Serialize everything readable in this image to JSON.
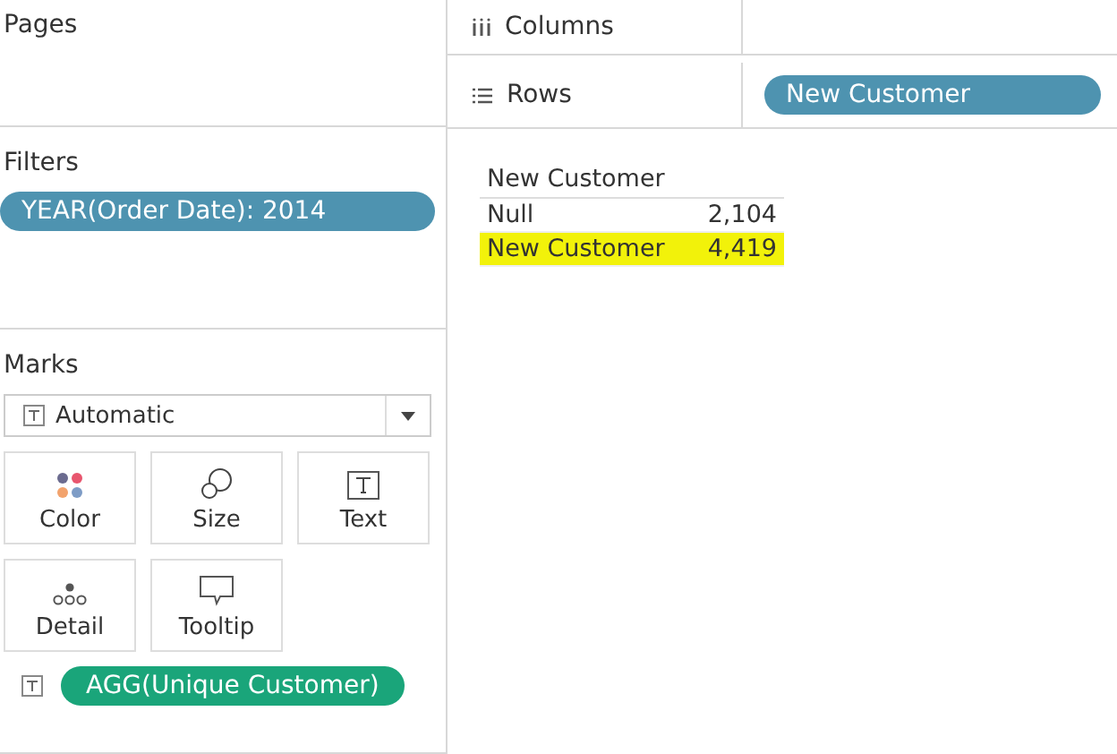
{
  "pages": {
    "title": "Pages"
  },
  "filters": {
    "title": "Filters",
    "pills": [
      "YEAR(Order Date): 2014"
    ]
  },
  "marks": {
    "title": "Marks",
    "mark_type": "Automatic",
    "cards": [
      {
        "kind": "color",
        "label": "Color"
      },
      {
        "kind": "size",
        "label": "Size"
      },
      {
        "kind": "text",
        "label": "Text"
      },
      {
        "kind": "detail",
        "label": "Detail"
      },
      {
        "kind": "tooltip",
        "label": "Tooltip"
      }
    ],
    "fields": [
      {
        "kind": "text",
        "label": "AGG(Unique Customer)"
      }
    ]
  },
  "columns_shelf": {
    "title": "Columns"
  },
  "rows_shelf": {
    "title": "Rows",
    "pills": [
      "New Customer"
    ]
  },
  "table": {
    "header": "New Customer",
    "rows": [
      {
        "label": "Null",
        "value": "2,104",
        "highlighted": false
      },
      {
        "label": "New Customer",
        "value": "4,419",
        "highlighted": true
      }
    ]
  }
}
